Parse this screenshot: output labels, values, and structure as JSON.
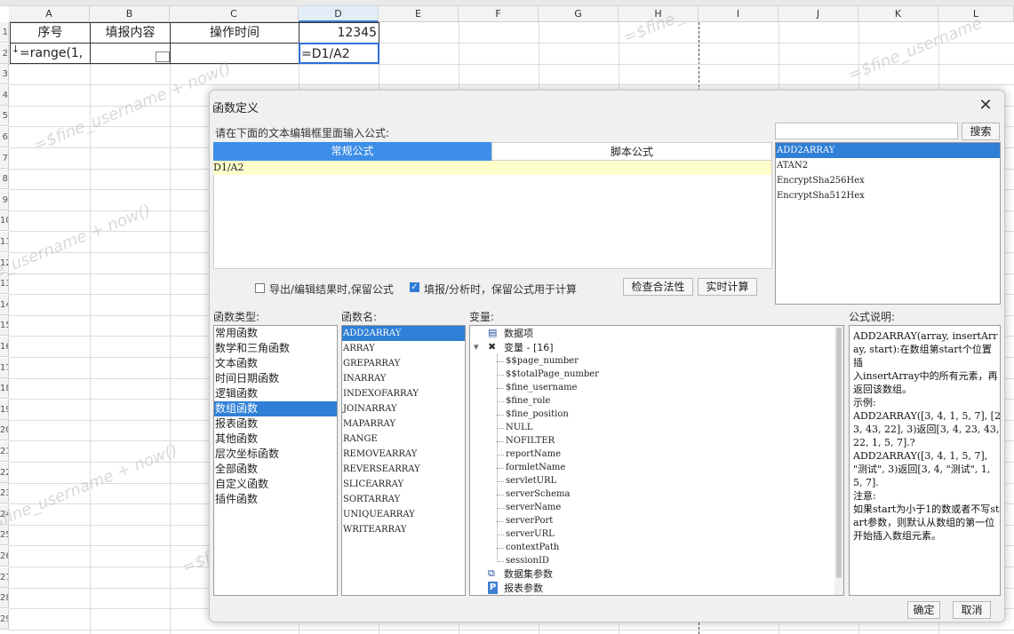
{
  "spreadsheet": {
    "columns": [
      "A",
      "B",
      "C",
      "D",
      "E",
      "F",
      "G",
      "H",
      "I",
      "J",
      "K",
      "L"
    ],
    "selected_column": "D",
    "row_numbers": [
      "1",
      "2",
      "3",
      "4",
      "5",
      "6",
      "7",
      "8",
      "9",
      "10",
      "11",
      "12",
      "13",
      "14",
      "15",
      "16",
      "17",
      "18",
      "19",
      "20",
      "21",
      "22",
      "23",
      "24",
      "25",
      "26",
      "27",
      "28",
      "29"
    ],
    "header_row": {
      "a1": "序号",
      "b1": "填报内容",
      "c1": "操作时间",
      "d1": "12345"
    },
    "row2": {
      "a2": "=range(1,",
      "d2": "=D1/A2"
    },
    "watermarks": [
      "=$fine_username",
      "=$fine_username + now()",
      "=$fine_username + now()",
      "=$fine_username",
      "=$fine_username + now()",
      "=$fine_username",
      "=$fine_"
    ]
  },
  "dialog": {
    "title": "函数定义",
    "close_icon": "close-icon",
    "prompt": "请在下面的文本编辑框里面输入公式:",
    "tabs": [
      {
        "label": "常规公式",
        "active": true
      },
      {
        "label": "脚本公式",
        "active": false
      }
    ],
    "formula_text": "D1/A2",
    "search_placeholder": "",
    "search_button": "搜索",
    "search_results": [
      "ADD2ARRAY",
      "ATAN2",
      "EncryptSha256Hex",
      "EncryptSha512Hex"
    ],
    "search_selected_index": 0,
    "option_export": {
      "label": "导出/编辑结果时,保留公式",
      "checked": false
    },
    "option_fill": {
      "label": "填报/分析时，保留公式用于计算",
      "checked": true
    },
    "check_button": "检查合法性",
    "realtime_button": "实时计算",
    "category_label": "函数类型:",
    "categories": [
      "常用函数",
      "数学和三角函数",
      "文本函数",
      "时间日期函数",
      "逻辑函数",
      "数组函数",
      "报表函数",
      "其他函数",
      "层次坐标函数",
      "全部函数",
      "自定义函数",
      "插件函数"
    ],
    "category_selected_index": 5,
    "function_label": "函数名:",
    "functions": [
      "ADD2ARRAY",
      "ARRAY",
      "GREPARRAY",
      "INARRAY",
      "INDEXOFARRAY",
      "JOINARRAY",
      "MAPARRAY",
      "RANGE",
      "REMOVEARRAY",
      "REVERSEARRAY",
      "SLICEARRAY",
      "SORTARRAY",
      "UNIQUEARRAY",
      "WRITEARRAY"
    ],
    "function_selected_index": 0,
    "variable_label": "变量:",
    "variable_tree": {
      "data_item": "数据项",
      "variables_group": "变量 - [16]",
      "variables": [
        "$$page_number",
        "$$totalPage_number",
        "$fine_username",
        "$fine_role",
        "$fine_position",
        "NULL",
        "NOFILTER",
        "reportName",
        "formletName",
        "servletURL",
        "serverSchema",
        "serverName",
        "serverPort",
        "serverURL",
        "contextPath",
        "sessionID"
      ],
      "dataset_params": "数据集参数",
      "report_params": "报表参数"
    },
    "description_label": "公式说明:",
    "description_lines": [
      "ADD2ARRAY(array, insertArray, start):在数组第start个位置插",
      "入insertArray中的所有元素，再返回该数组。",
      "示例:",
      "ADD2ARRAY([3, 4, 1, 5, 7], [23, 43, 22], 3)返回[3, 4, 23, 43, 22, 1, 5, 7].?",
      "ADD2ARRAY([3, 4, 1, 5, 7], \"测试\", 3)返回[3, 4, \"测试\", 1, 5, 7].",
      "注意:",
      "如果start为小于1的数或者不写start参数，则默认从数组的第一位开始插入数组元素。"
    ],
    "ok_button": "确定",
    "cancel_button": "取消"
  }
}
